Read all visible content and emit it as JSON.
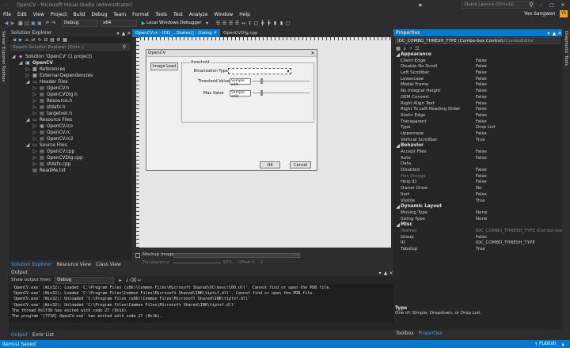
{
  "title": {
    "app_title": "OpenCV - Microsoft Visual Studio (Administrator)",
    "quick_launch": "Quick Launch (Ctrl+Q)",
    "user": "Yoo Sangwon",
    "avatar_initials": "YS"
  },
  "menu": [
    "File",
    "Edit",
    "View",
    "Project",
    "Build",
    "Debug",
    "Team",
    "Format",
    "Tools",
    "Test",
    "Analyze",
    "Window",
    "Help"
  ],
  "toolbar": {
    "config": "Debug",
    "platform": "x64",
    "run_label": "Local Windows Debugger"
  },
  "left_strip": {
    "server_explorer": "Server Explorer",
    "toolbox": "Toolbox"
  },
  "solution_explorer": {
    "title": "Solution Explorer",
    "search_placeholder": "Search Solution Explorer (Ctrl+;)",
    "items": [
      {
        "label": "Solution 'OpenCV' (1 project)",
        "depth": 0,
        "icon": "solution-icon",
        "color": "#c8a6ea"
      },
      {
        "label": "OpenCV",
        "depth": 1,
        "icon": "project-icon",
        "color": "#9ec9ff",
        "bold": true
      },
      {
        "label": "References",
        "depth": 2,
        "icon": "references-icon",
        "color": "#d0d0d0"
      },
      {
        "label": "External Dependencies",
        "depth": 2,
        "icon": "external-dependencies-icon",
        "color": "#d0d0d0"
      },
      {
        "label": "Header Files",
        "depth": 2,
        "icon": "folder-icon",
        "color": "#dcb67a"
      },
      {
        "label": "OpenCV.h",
        "depth": 3,
        "icon": "header-file-icon",
        "color": "#a9a9a9"
      },
      {
        "label": "OpenCVDlg.h",
        "depth": 3,
        "icon": "header-file-icon",
        "color": "#a9a9a9"
      },
      {
        "label": "Resource.h",
        "depth": 3,
        "icon": "header-file-icon",
        "color": "#a9a9a9"
      },
      {
        "label": "stdafx.h",
        "depth": 3,
        "icon": "header-file-icon",
        "color": "#a9a9a9"
      },
      {
        "label": "targetver.h",
        "depth": 3,
        "icon": "header-file-icon",
        "color": "#a9a9a9"
      },
      {
        "label": "Resource Files",
        "depth": 2,
        "icon": "folder-icon",
        "color": "#dcb67a"
      },
      {
        "label": "OpenCV.ico",
        "depth": 3,
        "icon": "ico-file-icon",
        "color": "#a9a9a9"
      },
      {
        "label": "OpenCV.rc",
        "depth": 3,
        "icon": "rc-file-icon",
        "color": "#a9a9a9"
      },
      {
        "label": "OpenCV.rc2",
        "depth": 3,
        "icon": "rc2-file-icon",
        "color": "#a9a9a9"
      },
      {
        "label": "Source Files",
        "depth": 2,
        "icon": "folder-icon",
        "color": "#dcb67a"
      },
      {
        "label": "OpenCV.cpp",
        "depth": 3,
        "icon": "cpp-file-icon",
        "color": "#a9a9a9"
      },
      {
        "label": "OpenCVDlg.cpp",
        "depth": 3,
        "icon": "cpp-file-icon",
        "color": "#a9a9a9"
      },
      {
        "label": "stdafx.cpp",
        "depth": 3,
        "icon": "cpp-file-icon",
        "color": "#a9a9a9"
      },
      {
        "label": "ReadMe.txt",
        "depth": 2,
        "icon": "text-file-icon",
        "color": "#a9a9a9"
      }
    ],
    "bottom_tabs": [
      "Solution Explorer",
      "Resource View",
      "Class View"
    ]
  },
  "editor": {
    "tabs": [
      "OpenCV.rc - IDD_...States)] - Dialog",
      "OpenCVDlg.cpp"
    ],
    "dialog": {
      "title": "OpenCV",
      "image_load_button": "Image Load",
      "group_label": "threshold",
      "binarization_label": "Binarization Type",
      "threshold_label": "Threshold Value",
      "threshold_edit": "Sample edit",
      "max_label": "Max Value",
      "max_edit": "Sample edit",
      "ok_button": "OK",
      "cancel_button": "Cancel"
    },
    "mockup": {
      "checkbox_label": "Mockup Image",
      "transparency_label": "Transparency",
      "percent": "50%",
      "offset_label": "Offset X:",
      "offset_x": "0"
    }
  },
  "properties": {
    "title": "Properties",
    "object": "IDC_COMBO_THRESH_TYPE (Combo-box Control)",
    "object_type": "IComboEditor",
    "categories": [
      {
        "name": "Appearance",
        "rows": [
          [
            "Client Edge",
            "False"
          ],
          [
            "Disable No Scroll",
            "False"
          ],
          [
            "Left Scrollbar",
            "False"
          ],
          [
            "Lowercase",
            "False"
          ],
          [
            "Modal Frame",
            "False"
          ],
          [
            "No Integral Height",
            "False"
          ],
          [
            "OEM Convert",
            "False"
          ],
          [
            "Right Align Text",
            "False"
          ],
          [
            "Right To Left Reading Order",
            "False"
          ],
          [
            "Static Edge",
            "False"
          ],
          [
            "Transparent",
            "False"
          ],
          [
            "Type",
            "Drop List"
          ],
          [
            "Uppercase",
            "False"
          ],
          [
            "Vertical Scrollbar",
            "True"
          ]
        ]
      },
      {
        "name": "Behavior",
        "rows": [
          [
            "Accept Files",
            "False"
          ],
          [
            "Auto",
            "False"
          ],
          [
            "Data",
            ""
          ],
          [
            "Disabled",
            "False"
          ],
          [
            "Has Strings",
            "False"
          ],
          [
            "Help ID",
            "False"
          ],
          [
            "Owner Draw",
            "No"
          ],
          [
            "Sort",
            "False"
          ],
          [
            "Visible",
            "True"
          ]
        ]
      },
      {
        "name": "Dynamic Layout",
        "rows": [
          [
            "Moving Type",
            "None"
          ],
          [
            "Sizing Type",
            "None"
          ]
        ]
      },
      {
        "name": "Misc",
        "rows": [
          [
            "(Name)",
            "IDC_COMBO_THRESH_TYPE (Combo-box"
          ],
          [
            "Group",
            "False"
          ],
          [
            "ID",
            "IDC_COMBO_THRESH_TYPE"
          ],
          [
            "Tabstop",
            "True"
          ]
        ]
      }
    ],
    "desc_title": "Type",
    "desc_text": "One of: Simple, Dropdown, or Drop List.",
    "bottom_tabs": [
      "Toolbox",
      "Properties"
    ]
  },
  "right_strip": {
    "diagnostic_tools": "Diagnostic Tools"
  },
  "output": {
    "title": "Output",
    "show_from_label": "Show output from:",
    "show_from_value": "Debug",
    "lines": [
      "'OpenCV.exe' (Win32): Loaded 'C:\\Program Files (x86)\\Common Files\\Microsoft Shared\\VC\\msvcr100.dll'. Cannot find or open the PDB file.",
      "'OpenCV.exe' (Win32): Loaded 'C:\\Program Files\\Common Files\\Microsoft Shared\\INK\\tiptsf.dll'. Cannot find or open the PDB file.",
      "'OpenCV.exe' (Win32): Unloaded 'C:\\Program Files (x86)\\Common Files\\Microsoft Shared\\INK\\tiptsf.dll'",
      "'OpenCV.exe' (Win32): Unloaded 'C:\\Program Files\\Common Files\\Microsoft Shared\\INK\\tiptsf.dll'",
      "The thread 0x1f38 has exited with code 27 (0x1b).",
      "The program '[7716] OpenCV.exe' has exited with code 27 (0x1b)."
    ],
    "bottom_tabs": [
      "Output",
      "Error List"
    ]
  },
  "status": {
    "left": "Item(s) Saved",
    "right": "Publish"
  },
  "colors": {
    "accent": "#007acc",
    "bg": "#2d2d30",
    "panel": "#252526"
  }
}
